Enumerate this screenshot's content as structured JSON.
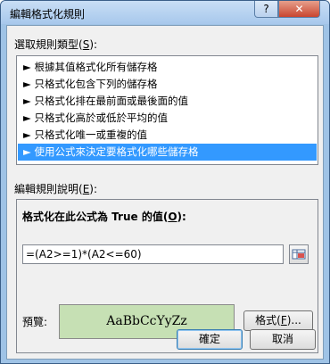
{
  "window": {
    "title": "編輯格式化規則",
    "help": "?",
    "close": "✕"
  },
  "rule_type": {
    "label": "選取規則類型(",
    "accel": "S",
    "label_end": "):",
    "items": [
      "► 根據其值格式化所有儲存格",
      "► 只格式化包含下列的儲存格",
      "► 只格式化排在最前面或最後面的值",
      "► 只格式化高於或低於平均的值",
      "► 只格式化唯一或重複的值",
      "► 使用公式來決定要格式化哪些儲存格"
    ],
    "selected_index": 5
  },
  "description": {
    "label": "編輯規則說明(",
    "accel": "E",
    "label_end": "):",
    "formula_label": "格式化在此公式為 True 的值(",
    "formula_accel": "O",
    "formula_label_end": "):",
    "formula_value": "=(A2>=1)*(A2<=60)",
    "preview_label": "預覽:",
    "preview_text": "AaBbCcYyZz",
    "preview_color": "#c6e0b4",
    "format_button": "格式(",
    "format_accel": "F",
    "format_button_end": ")..."
  },
  "buttons": {
    "ok": "確定",
    "cancel": "取消"
  }
}
